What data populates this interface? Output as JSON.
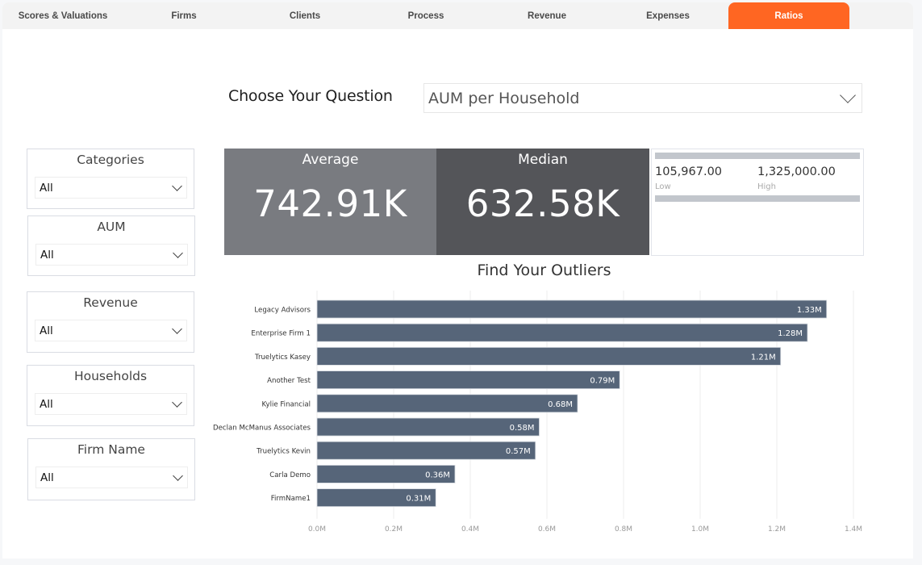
{
  "tabs": [
    {
      "label": "Scores & Valuations",
      "active": false
    },
    {
      "label": "Firms",
      "active": false
    },
    {
      "label": "Clients",
      "active": false
    },
    {
      "label": "Process",
      "active": false
    },
    {
      "label": "Revenue",
      "active": false
    },
    {
      "label": "Expenses",
      "active": false
    },
    {
      "label": "Ratios",
      "active": true
    }
  ],
  "question": {
    "label": "Choose Your Question",
    "selected": "AUM per Household"
  },
  "slicers": [
    {
      "title": "Categories",
      "value": "All"
    },
    {
      "title": "AUM",
      "value": "All"
    },
    {
      "title": "Revenue",
      "value": "All"
    },
    {
      "title": "Households",
      "value": "All"
    },
    {
      "title": "Firm Name",
      "value": "All"
    }
  ],
  "kpis": {
    "average": {
      "label": "Average",
      "value": "742.91K"
    },
    "median": {
      "label": "Median",
      "value": "632.58K"
    }
  },
  "range": {
    "low_value": "105,967.00",
    "low_label": "Low",
    "high_value": "1,325,000.00",
    "high_label": "High"
  },
  "colors": {
    "accent": "#ff6622",
    "bar": "#566579",
    "average_card": "#797b80",
    "median_card": "#545559"
  },
  "chart_data": {
    "type": "bar",
    "orientation": "horizontal",
    "title": "Find Your Outliers",
    "xlabel": "",
    "ylabel": "",
    "categories": [
      "Legacy Advisors",
      "Enterprise Firm 1",
      "Truelytics Kasey",
      "Another Test",
      "Kylie Financial",
      "Declan McManus Associates",
      "Truelytics Kevin",
      "Carla Demo",
      "FirmName1"
    ],
    "values": [
      1.33,
      1.28,
      1.21,
      0.79,
      0.68,
      0.58,
      0.57,
      0.36,
      0.31
    ],
    "value_labels": [
      "1.33M",
      "1.28M",
      "1.21M",
      "0.79M",
      "0.68M",
      "0.58M",
      "0.57M",
      "0.36M",
      "0.31M"
    ],
    "units": "M",
    "xlim": [
      0,
      1.4
    ],
    "xticks": [
      0,
      0.2,
      0.4,
      0.6,
      0.8,
      1.0,
      1.2,
      1.4
    ],
    "xtick_labels": [
      "0.0M",
      "0.2M",
      "0.4M",
      "0.6M",
      "0.8M",
      "1.0M",
      "1.2M",
      "1.4M"
    ],
    "grid": true,
    "legend": "none"
  }
}
